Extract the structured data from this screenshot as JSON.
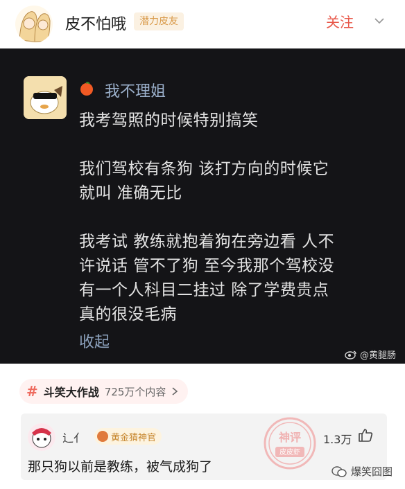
{
  "header": {
    "username": "皮不怕哦",
    "badge": "潜力皮友",
    "follow_label": "关注"
  },
  "post": {
    "author": "我不理姐",
    "lines": [
      "我考驾照的时候特别搞笑",
      "我们驾校有条狗 该打方向的时候它",
      "就叫 准确无比",
      "我考试 教练就抱着狗在旁边看 人不",
      "许说话 管不了狗 至今我那个驾校没",
      "有一个人科目二挂过 除了学费贵点",
      "真的很没毛病"
    ],
    "collapse_label": "收起",
    "watermark": "@黄腿肠"
  },
  "topic": {
    "hash": "#",
    "title": "斗笑大作战",
    "count": "725万个内容"
  },
  "comment": {
    "name": "辶亻",
    "badge": "黄金猜神官",
    "text": "那只狗以前是教练，被气成狗了",
    "likes": "1.3万",
    "stamp_top": "神评",
    "stamp_bottom": "皮皮虾"
  },
  "brand": "爆笑囧图",
  "colors": {
    "accent_red": "#e8584a",
    "post_bg": "#141417",
    "link_blue": "#8da2bd"
  }
}
